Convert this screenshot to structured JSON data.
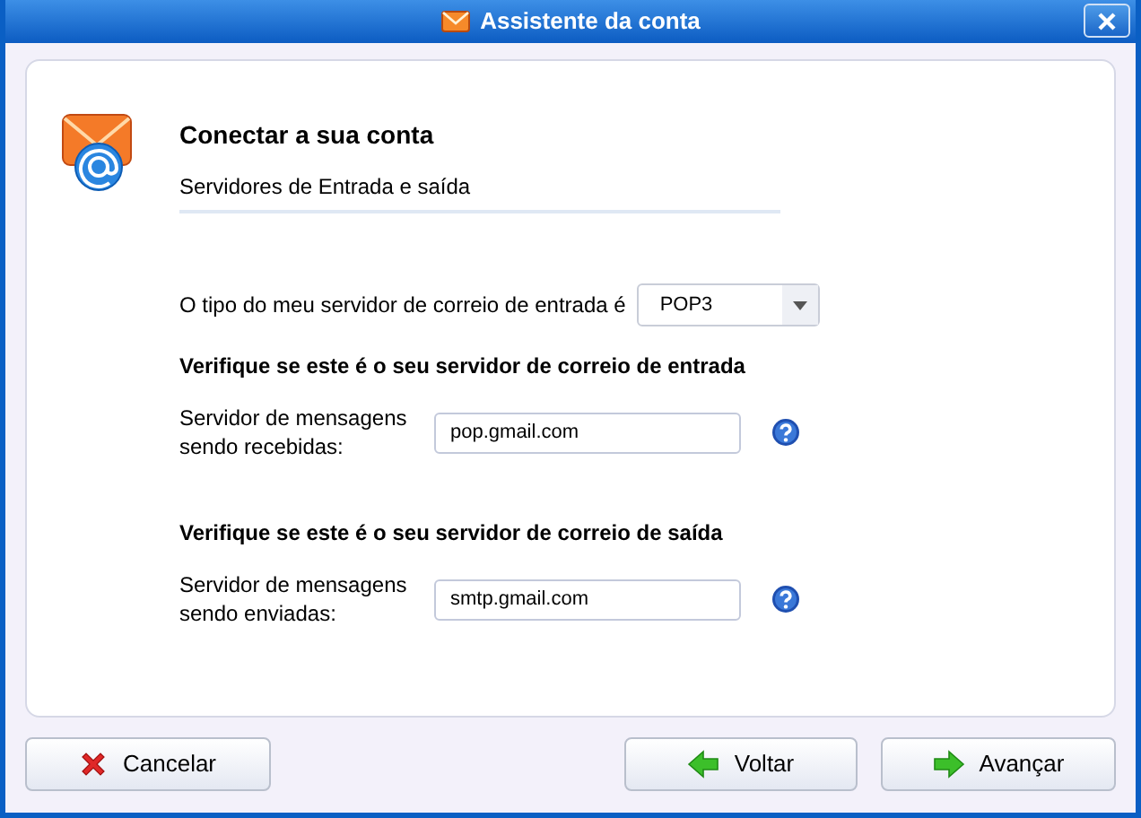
{
  "window": {
    "title": "Assistente da conta"
  },
  "header": {
    "title": "Conectar a sua conta",
    "subtitle": "Servidores de Entrada e saída"
  },
  "server_type": {
    "label": "O tipo do meu servidor de correio de entrada é",
    "value": "POP3"
  },
  "sections": [
    {
      "heading": "Verifique se este é o seu servidor de correio de entrada",
      "label": "Servidor de mensagens sendo recebidas:",
      "value": "pop.gmail.com"
    },
    {
      "heading": "Verifique se este é o seu servidor de correio de saída",
      "label": "Servidor de mensagens sendo enviadas:",
      "value": "smtp.gmail.com"
    }
  ],
  "buttons": [
    {
      "label": "Cancelar",
      "kind": "cancel"
    },
    {
      "label": "Voltar",
      "kind": "back"
    },
    {
      "label": "Avançar",
      "kind": "next"
    }
  ]
}
